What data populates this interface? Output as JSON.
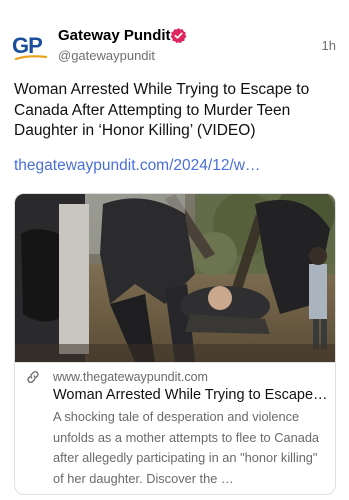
{
  "post": {
    "author": {
      "name": "Gateway Pundit",
      "handle": "@gatewaypundit",
      "avatar_text": "GP",
      "verified_badge_color": "#e0245e"
    },
    "time": "1h",
    "text": "Woman Arrested While Trying to Escape to Canada After Attempting to Murder Teen Daughter in ‘Honor Killing’ (VIDEO)",
    "link_text": "thegatewaypundit.com/2024/12/w…",
    "link_color": "#4a6fd8"
  },
  "card": {
    "domain": "www.thegatewaypundit.com",
    "title": "Woman Arrested While Trying to Escape to Canada After Attempting to Murder Teen Daughter in ‘Honor Killing’ (VIDEO)",
    "description": "A shocking tale of desperation and violence unfolds as a mother attempts to flee to Canada after allegedly participating in an \"honor killing\" of her daughter. Discover the …",
    "link_icon": "link-icon",
    "image_alt": "video-still-arrest-scene"
  }
}
